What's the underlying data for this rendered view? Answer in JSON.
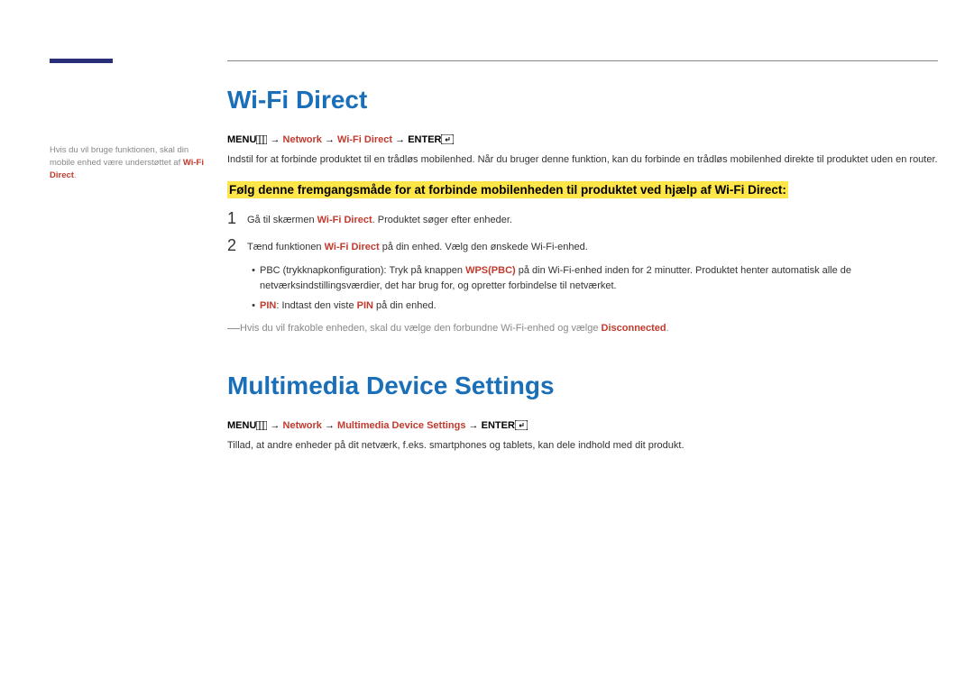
{
  "sidebar": {
    "note_prefix": "Hvis du vil bruge funktionen, skal din mobile enhed være understøttet af ",
    "note_hl": "Wi-Fi Direct",
    "note_suffix": "."
  },
  "section1": {
    "title": "Wi-Fi Direct",
    "menu_label": "MENU",
    "arrow": " → ",
    "nav1": "Network",
    "nav2": "Wi-Fi Direct",
    "enter_label": "ENTER",
    "desc": "Indstil for at forbinde produktet til en trådløs mobilenhed. Når du bruger denne funktion, kan du forbinde en trådløs mobilenhed direkte til produktet uden en router.",
    "highlight": "Følg denne fremgangsmåde for at forbinde mobilenheden til produktet ved hjælp af Wi-Fi Direct:",
    "step1_num": "1",
    "step1_pre": "Gå til skærmen ",
    "step1_hl": "Wi-Fi Direct",
    "step1_post": ". Produktet søger efter enheder.",
    "step2_num": "2",
    "step2_pre": "Tænd funktionen ",
    "step2_hl": "Wi-Fi Direct",
    "step2_post": " på din enhed. Vælg den ønskede Wi-Fi-enhed.",
    "bullet1_pre": "PBC (trykknapkonfiguration): Tryk på knappen ",
    "bullet1_hl": "WPS(PBC)",
    "bullet1_post": " på din Wi-Fi-enhed inden for 2 minutter. Produktet henter automatisk alle de netværksindstillingsværdier, det har brug for, og opretter forbindelse til netværket.",
    "bullet2_hl1": "PIN",
    "bullet2_mid": ": Indtast den viste ",
    "bullet2_hl2": "PIN",
    "bullet2_post": " på din enhed.",
    "note_pre": "Hvis du vil frakoble enheden, skal du vælge den forbundne Wi-Fi-enhed og vælge ",
    "note_hl": "Disconnected",
    "note_post": "."
  },
  "section2": {
    "title": "Multimedia Device Settings",
    "menu_label": "MENU",
    "arrow": " → ",
    "nav1": "Network",
    "nav2": "Multimedia Device Settings",
    "enter_label": "ENTER",
    "desc": "Tillad, at andre enheder på dit netværk, f.eks. smartphones og tablets, kan dele indhold med dit produkt."
  },
  "icons": {
    "menu": "menu-grid-icon",
    "enter": "enter-return-icon"
  }
}
